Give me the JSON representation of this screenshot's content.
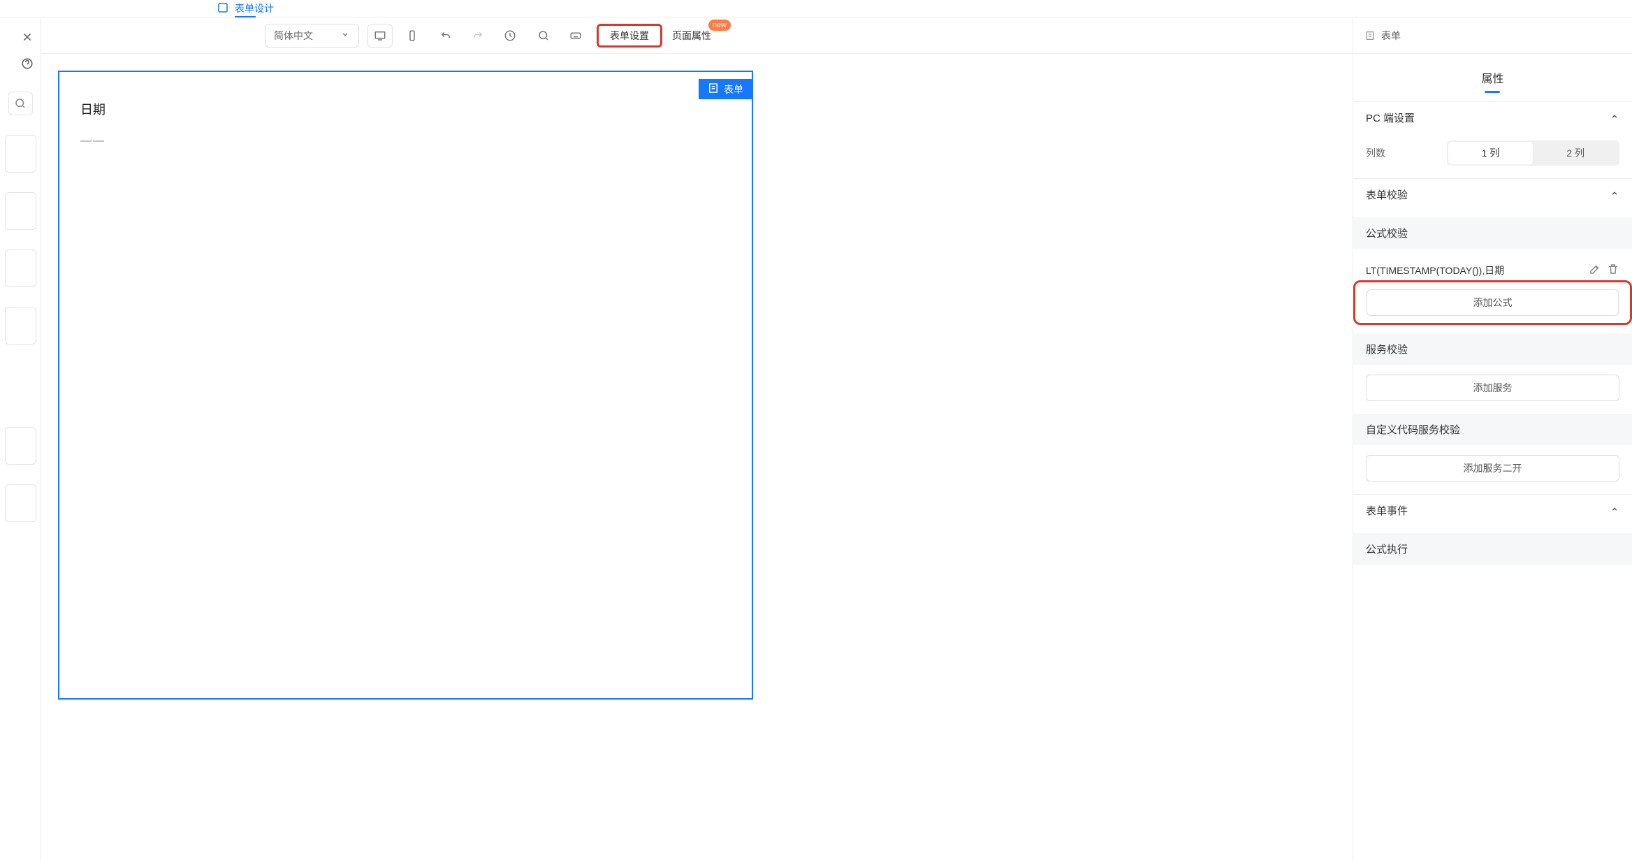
{
  "topNav": {
    "active": "表单设计",
    "items": [
      "表单设计"
    ]
  },
  "toolbar": {
    "lang": "简体中文",
    "formSettings": "表单设置",
    "pageProps": "页面属性",
    "badgeNew": "new"
  },
  "breadcrumb": {
    "label": "表单"
  },
  "canvas": {
    "formBadge": "表单",
    "field": {
      "label": "日期",
      "placeholder": "——"
    }
  },
  "rightPanel": {
    "tab": "属性",
    "pcSettings": {
      "title": "PC 端设置",
      "colsLabel": "列数",
      "col1": "1 列",
      "col2": "2 列"
    },
    "formValidate": {
      "title": "表单校验",
      "formulaValidate": "公式校验",
      "formulaText": "LT(TIMESTAMP(TODAY()),日期",
      "addFormula": "添加公式",
      "serviceValidate": "服务校验",
      "addService": "添加服务",
      "customCodeValidate": "自定义代码服务校验",
      "addService2": "添加服务二开"
    },
    "formEvent": {
      "title": "表单事件",
      "formulaExec": "公式执行"
    }
  }
}
